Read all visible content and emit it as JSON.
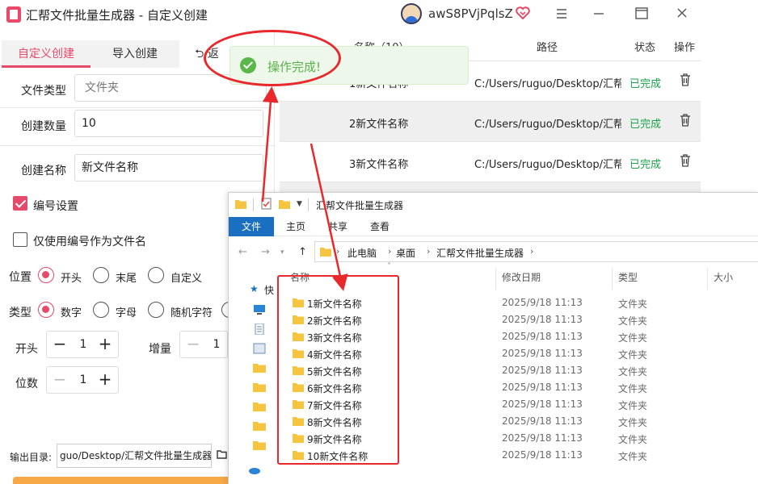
{
  "app": {
    "title": "汇帮文件批量生成器 - 自定义创建",
    "user": "awS8PVjPqlsZ",
    "colors": {
      "accent": "#e64a6a",
      "success": "#1aa34a",
      "annotation": "#e8282b"
    }
  },
  "tabs": {
    "custom": "自定义创建",
    "import": "导入创建",
    "back": "返"
  },
  "form": {
    "file_type_label": "文件类型",
    "file_type_value": "文件夹",
    "count_label": "创建数量",
    "count_value": "10",
    "name_label": "创建名称",
    "name_value": "新文件名称",
    "numbering_label": "编号设置",
    "numbering_checked": true,
    "only_number_label": "仅使用编号作为文件名",
    "only_number_checked": false,
    "position_label": "位置",
    "position_options": [
      "开头",
      "末尾",
      "自定义"
    ],
    "position_selected": "开头",
    "type_label": "类型",
    "type_options": [
      "数字",
      "字母",
      "随机字符"
    ],
    "type_selected": "数字",
    "start_label": "开头",
    "start_value": "1",
    "increment_label": "增量",
    "increment_value": "1",
    "digits_label": "位数",
    "digits_value": "1",
    "output_label": "输出目录:",
    "output_value": "guo/Desktop/汇帮文件批量生成器"
  },
  "table": {
    "headers": {
      "name": "名称（10）",
      "path": "路径",
      "status": "状态",
      "action": "操作"
    },
    "rows": [
      {
        "name": "1新文件名称",
        "path": "C:/Users/ruguo/Desktop/汇帮文",
        "status": "已完成"
      },
      {
        "name": "2新文件名称",
        "path": "C:/Users/ruguo/Desktop/汇帮文",
        "status": "已完成"
      },
      {
        "name": "3新文件名称",
        "path": "C:/Users/ruguo/Desktop/汇帮文",
        "status": "已完成"
      }
    ]
  },
  "toast": {
    "text": "操作完成!"
  },
  "explorer": {
    "title": "汇帮文件批量生成器",
    "ribbon": [
      "文件",
      "主页",
      "共享",
      "查看"
    ],
    "breadcrumb": [
      "此电脑",
      "桌面",
      "汇帮文件批量生成器"
    ],
    "quick_access": "快",
    "columns": {
      "name": "名称",
      "date": "修改日期",
      "type": "类型",
      "size": "大小"
    },
    "files": [
      {
        "name": "1新文件名称",
        "date": "2025/9/18 11:13",
        "type": "文件夹"
      },
      {
        "name": "2新文件名称",
        "date": "2025/9/18 11:13",
        "type": "文件夹"
      },
      {
        "name": "3新文件名称",
        "date": "2025/9/18 11:13",
        "type": "文件夹"
      },
      {
        "name": "4新文件名称",
        "date": "2025/9/18 11:13",
        "type": "文件夹"
      },
      {
        "name": "5新文件名称",
        "date": "2025/9/18 11:13",
        "type": "文件夹"
      },
      {
        "name": "6新文件名称",
        "date": "2025/9/18 11:13",
        "type": "文件夹"
      },
      {
        "name": "7新文件名称",
        "date": "2025/9/18 11:13",
        "type": "文件夹"
      },
      {
        "name": "8新文件名称",
        "date": "2025/9/18 11:13",
        "type": "文件夹"
      },
      {
        "name": "9新文件名称",
        "date": "2025/9/18 11:13",
        "type": "文件夹"
      },
      {
        "name": "10新文件名称",
        "date": "2025/9/18 11:13",
        "type": "文件夹"
      }
    ]
  }
}
